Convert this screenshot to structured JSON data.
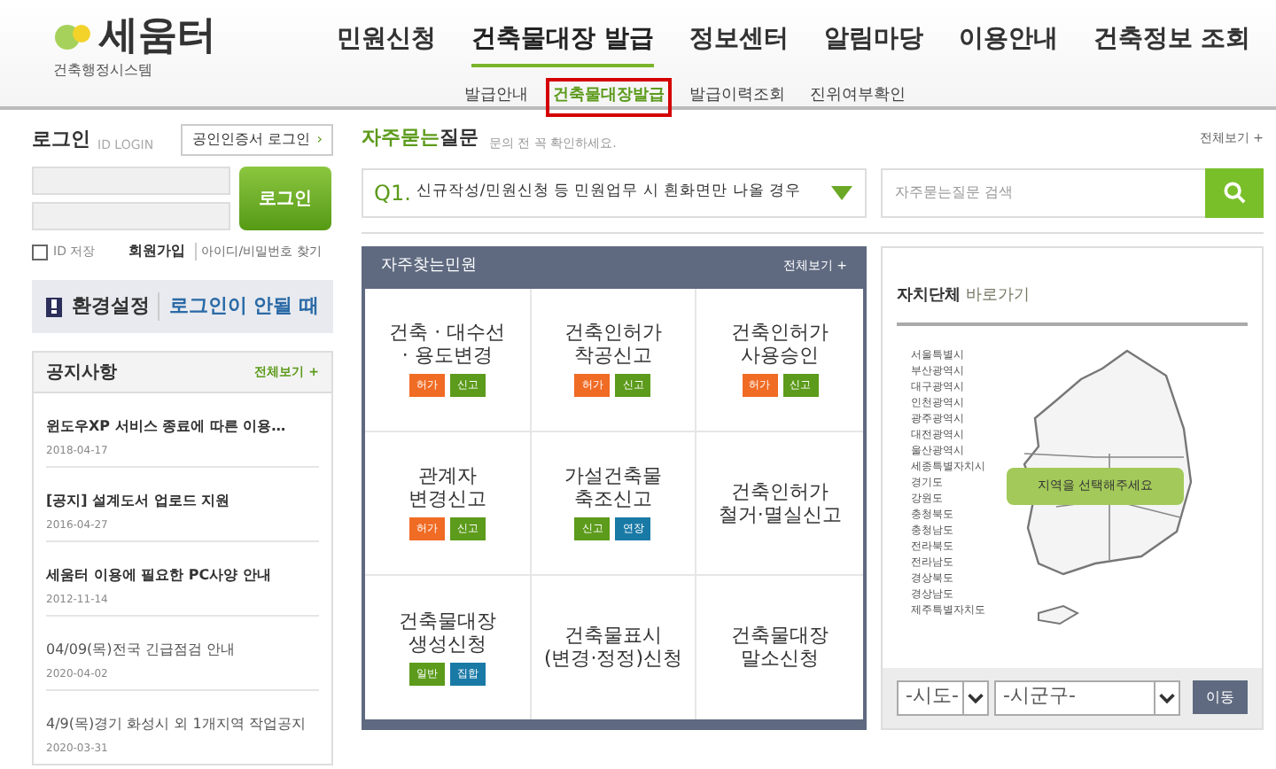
{
  "logo": {
    "name": "세움터",
    "subtitle": "건축행정시스템"
  },
  "nav": [
    {
      "label": "민원신청",
      "selected": false
    },
    {
      "label": "건축물대장 발급",
      "selected": true
    },
    {
      "label": "정보센터",
      "selected": false
    },
    {
      "label": "알림마당",
      "selected": false
    },
    {
      "label": "이용안내",
      "selected": false
    },
    {
      "label": "건축정보 조회",
      "selected": false
    }
  ],
  "subnav": [
    {
      "label": "발급안내",
      "selected": false
    },
    {
      "label": "건축물대장발급",
      "selected": true
    },
    {
      "label": "발급이력조회",
      "selected": false
    },
    {
      "label": "진위여부확인",
      "selected": false
    }
  ],
  "login": {
    "title": "로그인",
    "subtitle": "ID LOGIN",
    "cert_button": "공인인증서 로그인",
    "cert_arrow": "›",
    "submit": "로그인",
    "remember": {
      "label": "ID 저장",
      "checked": false
    },
    "join": "회원가입",
    "find": "아이디/비밀번호 찾기"
  },
  "help": {
    "settings": "환경설정",
    "trouble": "로그인이 안될 때"
  },
  "notices": {
    "title": "공지사항",
    "more": "전체보기 +",
    "items": [
      {
        "title": "윈도우XP 서비스 종료에 따른 이용…",
        "date": "2018-04-17",
        "bold": true
      },
      {
        "title": "[공지] 설계도서 업로드 지원",
        "date": "2016-04-27",
        "bold": true
      },
      {
        "title": "세움터 이용에 필요한 PC사양 안내",
        "date": "2012-11-14",
        "bold": true
      },
      {
        "title": "04/09(목)전국 긴급점검 안내",
        "date": "2020-04-02",
        "bold": false
      },
      {
        "title": "4/9(목)경기 화성시 외 1개지역 작업공지",
        "date": "2020-03-31",
        "bold": false
      }
    ]
  },
  "faq": {
    "title_accent": "자주묻는",
    "title": "질문",
    "hint": "문의 전 꼭 확인하세요.",
    "more": "전체보기 +",
    "question_no": "Q1.",
    "question": "신규작성/민원신청 등 민원업무 시 흰화면만 나올 경우",
    "search_placeholder": "자주묻는질문 검색"
  },
  "services": {
    "title": "자주찾는민원",
    "more": "전체보기 +",
    "items": [
      {
        "name": "건축 · 대수선\n· 용도변경",
        "tags": [
          {
            "label": "허가",
            "color": "#f06b24"
          },
          {
            "label": "신고",
            "color": "#5c9b1b"
          }
        ]
      },
      {
        "name": "건축인허가\n착공신고",
        "tags": [
          {
            "label": "허가",
            "color": "#f06b24"
          },
          {
            "label": "신고",
            "color": "#5c9b1b"
          }
        ]
      },
      {
        "name": "건축인허가\n사용승인",
        "tags": [
          {
            "label": "허가",
            "color": "#f06b24"
          },
          {
            "label": "신고",
            "color": "#5c9b1b"
          }
        ]
      },
      {
        "name": "관계자\n변경신고",
        "tags": [
          {
            "label": "허가",
            "color": "#f06b24"
          },
          {
            "label": "신고",
            "color": "#5c9b1b"
          }
        ]
      },
      {
        "name": "가설건축물\n축조신고",
        "tags": [
          {
            "label": "신고",
            "color": "#5c9b1b"
          },
          {
            "label": "연장",
            "color": "#1a7aa6"
          }
        ]
      },
      {
        "name": "건축인허가\n철거·멸실신고"
      },
      {
        "name": "건축물대장\n생성신청",
        "tags": [
          {
            "label": "일반",
            "color": "#5c9b1b"
          },
          {
            "label": "집합",
            "color": "#1a7aa6"
          }
        ]
      },
      {
        "name": "건축물표시\n(변경·정정)신청"
      },
      {
        "name": "건축물대장\n말소신청"
      }
    ]
  },
  "local": {
    "title": "자치단체",
    "title_accent": "바로가기",
    "regions": [
      "서울특별시",
      "부산광역시",
      "대구광역시",
      "인천광역시",
      "광주광역시",
      "대전광역시",
      "울산광역시",
      "세종특별자치시",
      "경기도",
      "강원도",
      "충청북도",
      "충청남도",
      "전라북도",
      "전라남도",
      "경상북도",
      "경상남도",
      "제주특별자치도"
    ],
    "map_label": "지역을 선택해주세요",
    "province_select": "-시도-",
    "city_select": "-시군구-",
    "go": "이동"
  }
}
